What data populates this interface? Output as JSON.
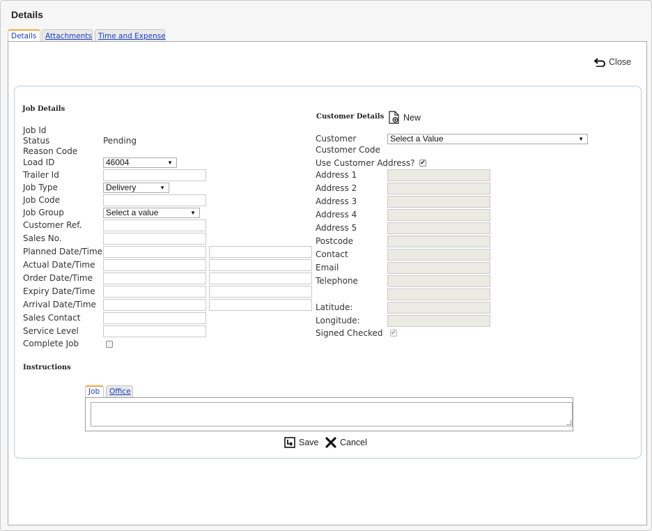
{
  "window": {
    "title": "Details"
  },
  "tabs": [
    {
      "label": "Details",
      "active": true
    },
    {
      "label": "Attachments",
      "active": false
    },
    {
      "label": "Time and Expense",
      "active": false
    }
  ],
  "close_label": "Close",
  "job_details": {
    "title": "Job Details",
    "labels": {
      "job_id": "Job Id",
      "status": "Status",
      "reason_code": "Reason Code",
      "load_id": "Load ID",
      "trailer_id": "Trailer Id",
      "job_type": "Job Type",
      "job_code": "Job Code",
      "job_group": "Job Group",
      "customer_ref": "Customer Ref.",
      "sales_no": "Sales No.",
      "planned_dt": "Planned Date/Time",
      "actual_dt": "Actual Date/Time",
      "order_dt": "Order Date/Time",
      "expiry_dt": "Expiry Date/Time",
      "arrival_dt": "Arrival Date/Time",
      "sales_contact": "Sales Contact",
      "service_level": "Service Level",
      "complete_job": "Complete Job"
    },
    "status_value": "Pending",
    "load_id_value": "46004",
    "job_type_value": "Delivery",
    "job_group_value": "Select a value"
  },
  "customer_details": {
    "title": "Customer Details",
    "new_label": "New",
    "labels": {
      "customer": "Customer",
      "customer_code": "Customer Code",
      "use_address": "Use Customer Address?",
      "address1": "Address 1",
      "address2": "Address 2",
      "address3": "Address 3",
      "address4": "Address 4",
      "address5": "Address 5",
      "postcode": "Postcode",
      "contact": "Contact",
      "email": "Email",
      "telephone": "Telephone",
      "latitude": "Latitude:",
      "longitude": "Longitude:",
      "signed_checked": "Signed Checked"
    },
    "customer_value": "Select a Value",
    "use_address_checked": true,
    "signed_checked": true
  },
  "instructions": {
    "title": "Instructions",
    "tabs": [
      {
        "label": "Job",
        "active": true
      },
      {
        "label": "Office",
        "active": false
      }
    ]
  },
  "actions": {
    "save_label": "Save",
    "cancel_label": "Cancel"
  }
}
